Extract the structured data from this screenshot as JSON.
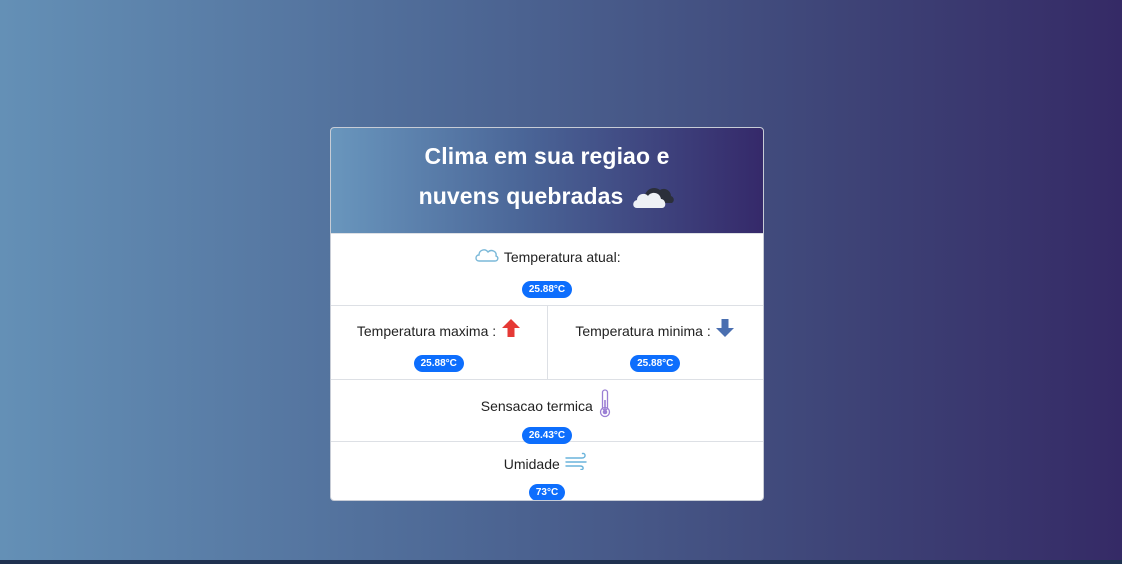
{
  "header": {
    "title_line1": "Clima em sua regiao e",
    "title_line2": "nuvens quebradas"
  },
  "current": {
    "label": "Temperatura atual:",
    "value": "25.88°C"
  },
  "max": {
    "label": "Temperatura maxima :",
    "value": "25.88°C"
  },
  "min": {
    "label": "Temperatura minima :",
    "value": "25.88°C"
  },
  "feels_like": {
    "label": "Sensacao termica",
    "value": "26.43°C"
  },
  "humidity": {
    "label": "Umidade",
    "value": "73°C"
  },
  "colors": {
    "badge": "#0d6efd",
    "arrow_up": "#e53935",
    "arrow_down": "#4a6fb0"
  },
  "icons": {
    "header": "broken-clouds-icon",
    "current": "cloud-outline-icon",
    "max": "arrow-up-icon",
    "min": "arrow-down-icon",
    "feels_like": "thermometer-icon",
    "humidity": "wind-icon"
  }
}
